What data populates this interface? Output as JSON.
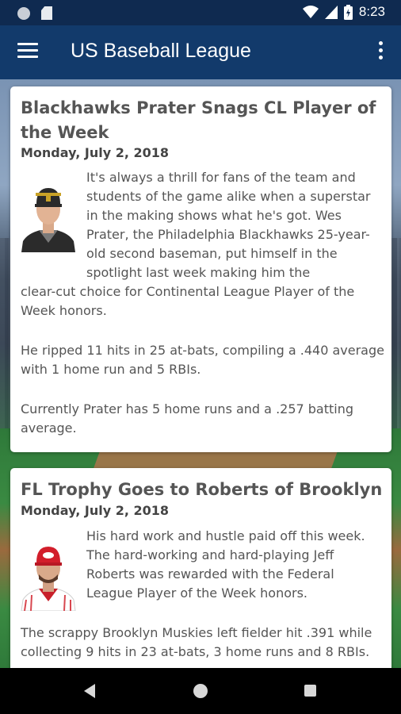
{
  "status_bar": {
    "time": "8:23",
    "icons": [
      "notification-dot-icon",
      "sd-card-icon",
      "wifi-icon",
      "signal-icon",
      "battery-icon"
    ]
  },
  "app_bar": {
    "title": "US Baseball League",
    "left_icon": "menu-icon",
    "right_icon": "more-vert-icon"
  },
  "articles": [
    {
      "title": "Blackhawks Prater Snags CL Player of the Week",
      "date": "Monday, July 2, 2018",
      "avatar": "player-photo-prater",
      "paragraphs": [
        "It's always a thrill for fans of the team and students of the game alike when a superstar in the making shows what he's got. Wes Prater, the Philadelphia Blackhawks 25-year-old second baseman, put himself in the spotlight last week making him the",
        "clear-cut choice for Continental League Player of the Week honors.",
        "He ripped 11 hits in 25 at-bats, compiling a .440 average with 1 home run and 5 RBIs.",
        "Currently Prater has 5 home runs and a .257 batting average."
      ]
    },
    {
      "title": "FL Trophy Goes to Roberts of Brooklyn",
      "date": "Monday, July 2, 2018",
      "avatar": "player-photo-roberts",
      "paragraphs": [
        "His hard work and hustle paid off this week. The hard-working and hard-playing Jeff Roberts was rewarded with the Federal League Player of the Week honors.",
        "The scrappy Brooklyn Muskies left fielder hit .391 while collecting 9 hits in 23 at-bats, 3 home runs and 8 RBIs."
      ]
    }
  ],
  "nav_bar": {
    "icons": [
      "back-icon",
      "home-icon",
      "recents-icon"
    ]
  },
  "colors": {
    "status_bar": "#0f2a50",
    "app_bar": "#123a6b",
    "card_text": "#555555"
  }
}
